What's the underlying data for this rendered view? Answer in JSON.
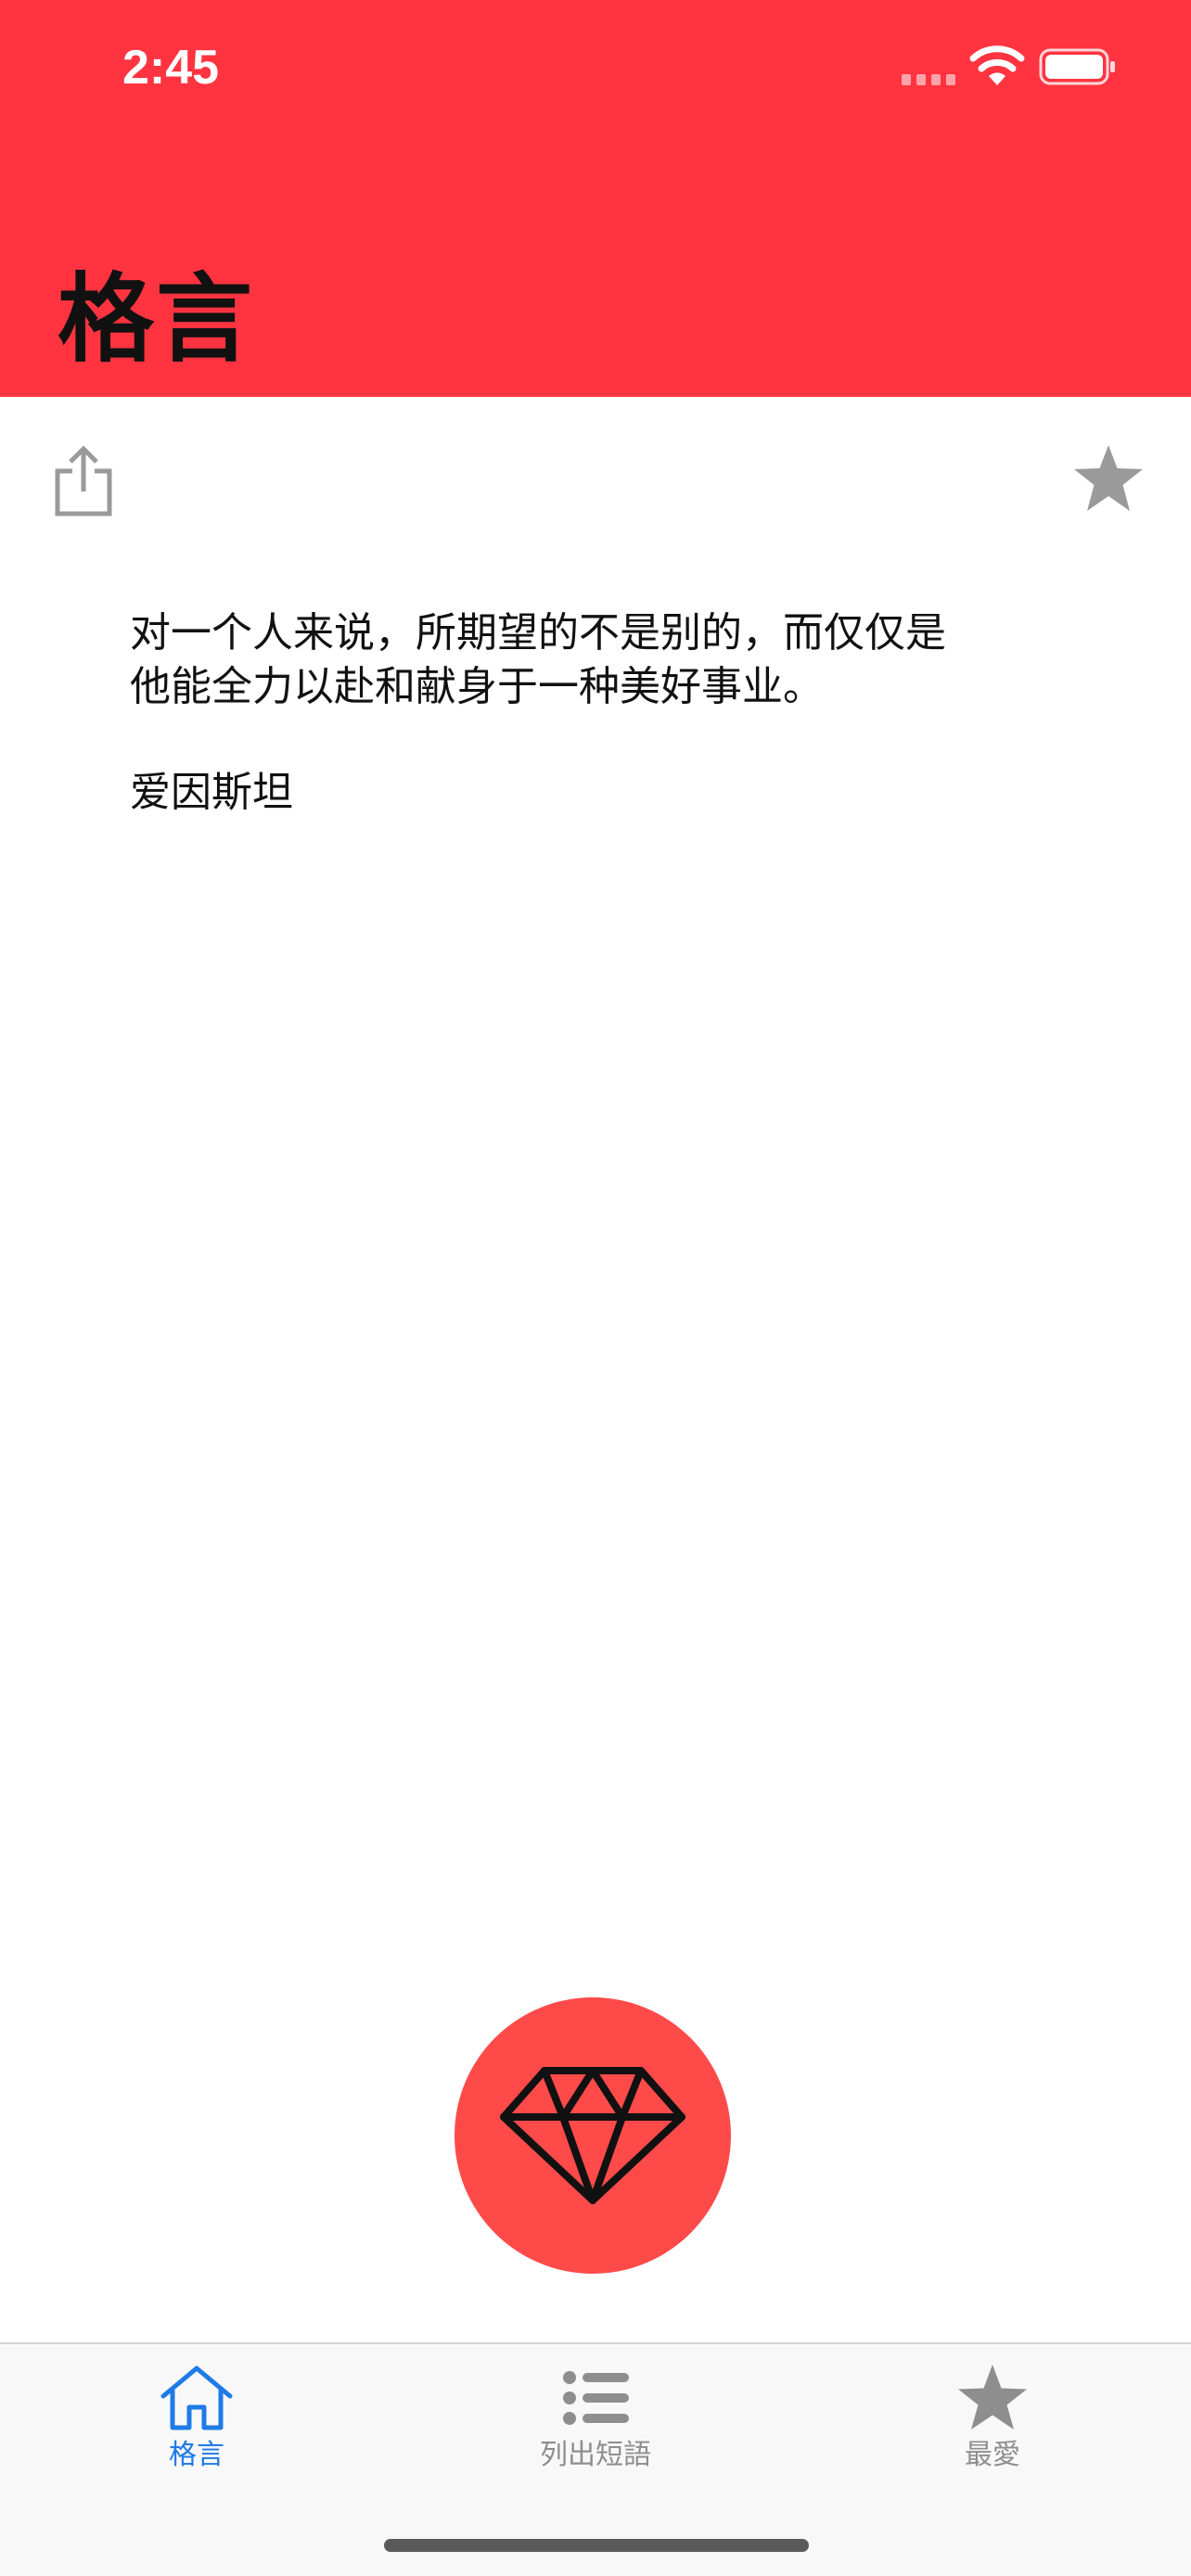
{
  "status_bar": {
    "time": "2:45"
  },
  "header": {
    "title": "格言",
    "background_color": "#FF3440"
  },
  "toolbar": {
    "share_icon": "share-icon",
    "favorite_icon": "star-icon"
  },
  "quote": {
    "lines": [
      "对一个人来说，所期望的不是别的，而仅仅是",
      "他能全力以赴和献身于一种美好事业。"
    ],
    "author": "爱因斯坦"
  },
  "fab": {
    "icon": "diamond-icon",
    "color": "#FF4A4A"
  },
  "tabs": [
    {
      "label": "格言",
      "icon": "home-icon",
      "active": true,
      "color": "#1E7BE6"
    },
    {
      "label": "列出短語",
      "icon": "list-icon",
      "active": false,
      "color": "#8E8E8E"
    },
    {
      "label": "最愛",
      "icon": "star-icon",
      "active": false,
      "color": "#8E8E8E"
    }
  ]
}
